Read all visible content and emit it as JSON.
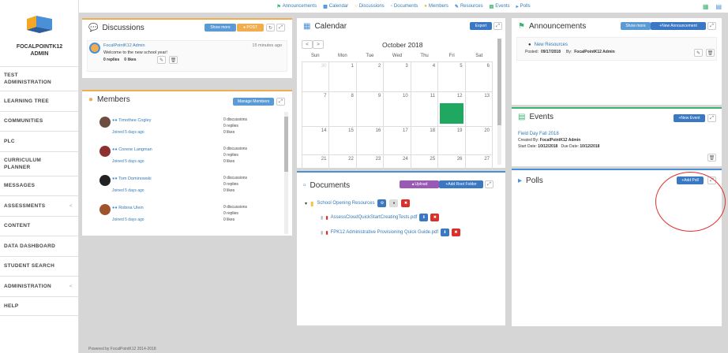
{
  "org": {
    "name_line1": "FOCALPOINTK12",
    "name_line2": "ADMIN"
  },
  "nav": [
    {
      "label_line1": "TEST",
      "label_line2": "ADMINISTRATION"
    },
    {
      "label": "LEARNING TREE"
    },
    {
      "label": "COMMUNITIES"
    },
    {
      "label": "PLC"
    },
    {
      "label_line1": "CURRICULUM",
      "label_line2": "PLANNER"
    },
    {
      "label": "MESSAGES"
    },
    {
      "label": "ASSESSMENTS",
      "chevron": "<"
    },
    {
      "label": "CONTENT"
    },
    {
      "label": "DATA DASHBOARD"
    },
    {
      "label": "STUDENT SEARCH"
    },
    {
      "label": "ADMINISTRATION",
      "chevron": "<"
    },
    {
      "label": "HELP"
    }
  ],
  "topnav": [
    "Announcements",
    "Calendar",
    "Discussions",
    "Documents",
    "Members",
    "Resources",
    "Events",
    "Polls"
  ],
  "discussions": {
    "title": "Discussions",
    "show_more": "Show more",
    "post": "POST",
    "author": "FocalPointK12 Admin",
    "time": "15 minutes ago",
    "message": "Welcome to the new school year!",
    "replies": "0 replies",
    "likes": "0 likes"
  },
  "members": {
    "title": "Members",
    "manage": "Manage Members",
    "list": [
      {
        "name": "Timothee Cogley",
        "joined": "Joined 5 days ago",
        "discussions": "0 discussions",
        "replies": "0 replies",
        "likes": "0 likes"
      },
      {
        "name": "Corene Langman",
        "joined": "Joined 5 days ago",
        "discussions": "0 discussions",
        "replies": "0 replies",
        "likes": "0 likes"
      },
      {
        "name": "Tom Dominowski",
        "joined": "Joined 5 days ago",
        "discussions": "0 discussions",
        "replies": "0 replies",
        "likes": "0 likes"
      },
      {
        "name": "Robina Ulein",
        "joined": "Joined 5 days ago",
        "discussions": "0 discussions",
        "replies": "0 replies",
        "likes": "0 likes"
      }
    ]
  },
  "calendar": {
    "title": "Calendar",
    "export": "Export",
    "month": "October 2018",
    "prev": "<",
    "next": ">",
    "days": [
      "Sun",
      "Mon",
      "Tue",
      "Wed",
      "Thu",
      "Fri",
      "Sat"
    ],
    "weeks": [
      [
        "30",
        "1",
        "2",
        "3",
        "4",
        "5",
        "6"
      ],
      [
        "7",
        "8",
        "9",
        "10",
        "11",
        "12",
        "13"
      ],
      [
        "14",
        "15",
        "16",
        "17",
        "18",
        "19",
        "20"
      ],
      [
        "21",
        "22",
        "23",
        "24",
        "25",
        "26",
        "27"
      ]
    ]
  },
  "documents": {
    "title": "Documents",
    "upload": "Upload",
    "add_root": "Add Root Folder",
    "folder": "School Opening Resources",
    "files": [
      "AssessCloudQuickStartCreatingTests.pdf",
      "FPK12 Administrative Provisioning Quick Guide.pdf"
    ]
  },
  "announcements": {
    "title": "Announcements",
    "show_more": "Show more",
    "new": "New Announcement",
    "item_title": "New Resources",
    "posted_label": "Posted:",
    "posted": "09/17/2018",
    "by_label": "By:",
    "by": "FocalPointK12 Admin"
  },
  "events": {
    "title": "Events",
    "new": "New Event",
    "item_title": "Field Day Fall 2018",
    "created_label": "Created By:",
    "created_by": "FocalPointK12 Admin",
    "start_label": "Start Date:",
    "start": "10/12/2018",
    "due_label": "Due Date:",
    "due": "10/12/2018"
  },
  "polls": {
    "title": "Polls",
    "add": "Add Poll"
  },
  "footer": "Powered by FocalPointK12 2014-2018",
  "colors": {
    "accent_orange": "#f0ad4e",
    "accent_green": "#3cb371",
    "accent_blue": "#4a90d9",
    "event_green": "#20a860"
  }
}
